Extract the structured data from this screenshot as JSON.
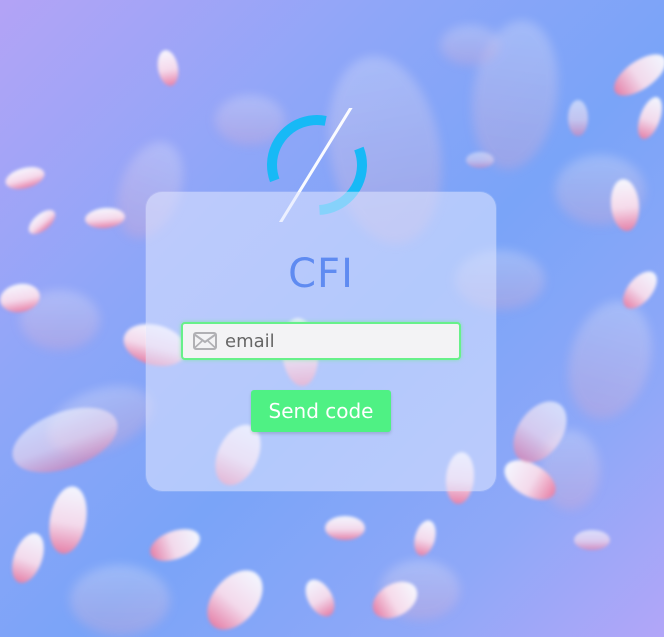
{
  "app": {
    "title": "CFI"
  },
  "form": {
    "email_placeholder": "email",
    "email_value": "",
    "submit_label": "Send code"
  },
  "icons": {
    "email": "envelope-icon",
    "loading": "loading-spinner"
  },
  "colors": {
    "title": "#5f8bf1",
    "button": "#4ff184",
    "input_border": "#67f08a",
    "spinner": "#17b9f6"
  }
}
